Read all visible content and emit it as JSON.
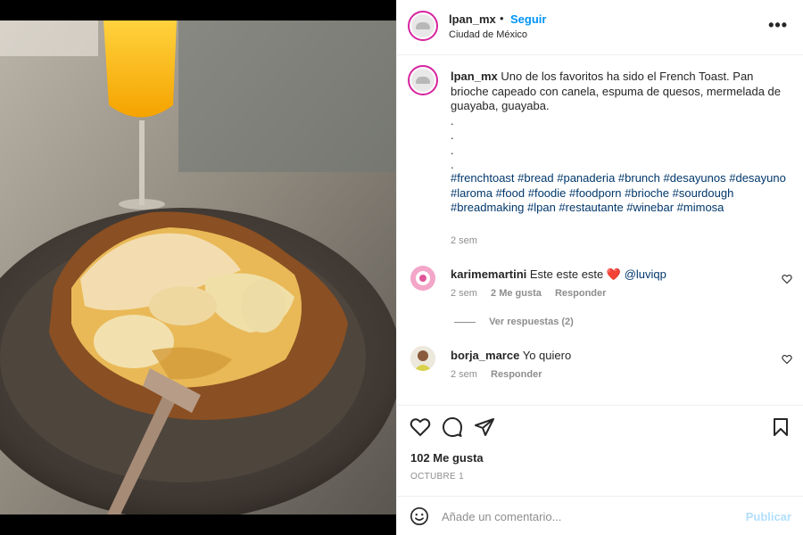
{
  "post": {
    "username": "lpan_mx",
    "separator": "•",
    "follow_label": "Seguir",
    "location": "Ciudad de México",
    "more_label": "•••"
  },
  "caption": {
    "username": "lpan_mx",
    "text": "Uno de los favoritos ha sido el French Toast. Pan brioche capeado con canela, espuma de quesos, mermelada de guayaba, guayaba.",
    "dots": [
      ".",
      ".",
      ".",
      "."
    ],
    "hashtags": "#frenchtoast #bread #panaderia #brunch #desayunos #desayuno #laroma #food #foodie #foodporn #brioche #sourdough #breadmaking #lpan #restautante #winebar #mimosa",
    "time": "2 sem"
  },
  "comments": [
    {
      "username": "karimemartini",
      "text": "Este este este",
      "emoji": "❤️",
      "mention": "@luviqp",
      "time": "2 sem",
      "likes": "2 Me gusta",
      "reply": "Responder"
    },
    {
      "username": "borja_marce",
      "text": "Yo quiero",
      "time": "2 sem",
      "reply": "Responder"
    }
  ],
  "replies_label": "Ver respuestas (2)",
  "likes_count": "102 Me gusta",
  "date": "OCTUBRE 1",
  "comment_box": {
    "placeholder": "Añade un comentario...",
    "publish_label": "Publicar"
  },
  "colors": {
    "link_blue": "#0095f6",
    "hashtag_blue": "#00376b",
    "muted": "#8e8e8e",
    "publish_disabled": "#b2dffc"
  }
}
